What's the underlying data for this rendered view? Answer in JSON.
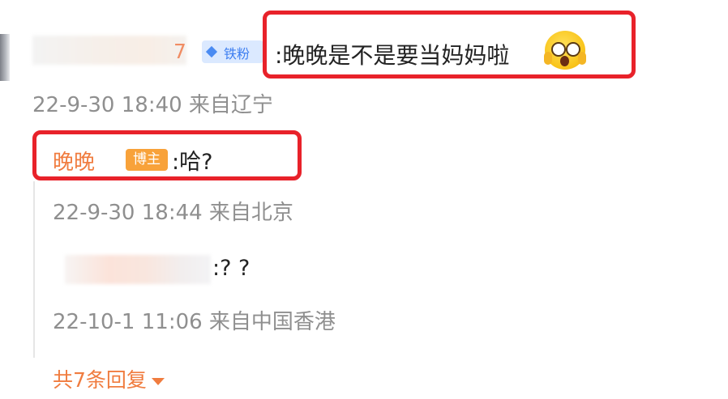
{
  "comment": {
    "username_visible_suffix": "7",
    "fan_badge": "铁粉",
    "text": ":晚晚是不是要当妈妈啦",
    "emoji": "scream-face-emoji",
    "timestamp": "22-9-30 18:40 来自辽宁"
  },
  "replies": [
    {
      "username": "晚晚",
      "badge": "博主",
      "text": ":哈?",
      "timestamp": "22-9-30 18:44 来自北京"
    },
    {
      "text": ":? ?",
      "timestamp": "22-10-1 11:06 来自中国香港"
    }
  ],
  "more_replies": "共7条回复",
  "colors": {
    "highlight_box": "#e8222a",
    "accent_orange": "#f07c3f",
    "badge_blue": "#3d7ef0",
    "timestamp_gray": "#8f8f8f"
  }
}
